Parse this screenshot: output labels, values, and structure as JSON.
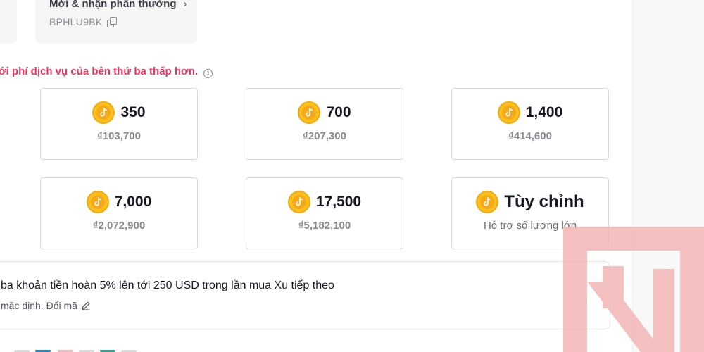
{
  "referral": {
    "title": "Mời & nhận phần thưởng",
    "chevron": "›",
    "code": "BPHLU9BK",
    "copy_icon": "copy-icon"
  },
  "notice": {
    "text": "ới phí dịch vụ của bên thứ ba thấp hơn.",
    "info_icon": "i",
    "color": "#e8345c"
  },
  "packages": [
    {
      "coins": "350",
      "price": "₫103,700"
    },
    {
      "coins": "700",
      "price": "₫207,300"
    },
    {
      "coins": "1,400",
      "price": "₫414,600"
    },
    {
      "coins": "7,000",
      "price": "₫2,072,900"
    },
    {
      "coins": "17,500",
      "price": "₫5,182,100"
    },
    {
      "coins": "Tùy chỉnh",
      "price": "Hỗ trợ số lượng lớn"
    }
  ],
  "promo": {
    "title": "ba khoản tiền hoàn 5% lên tới 250 USD trong lần mua Xu tiếp theo",
    "subtitle": "mặc định.",
    "change_code": "Đổi mã"
  },
  "colors": {
    "coin": "#f9c11a",
    "watermark": "#f4b6b6"
  }
}
